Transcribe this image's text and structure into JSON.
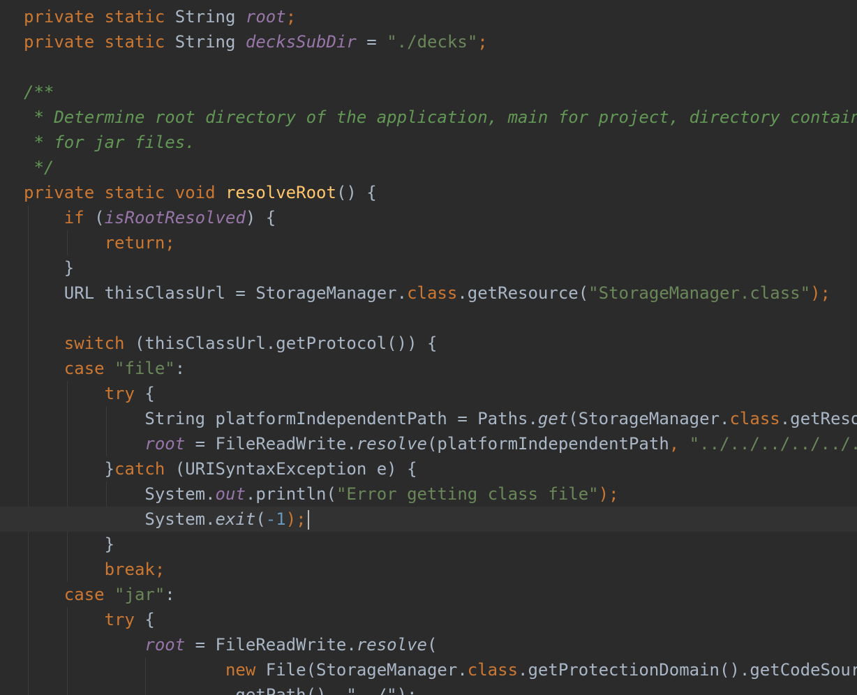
{
  "editor": {
    "current_line_index": 20,
    "lines": [
      {
        "tokens": [
          {
            "t": "private static ",
            "c": "kw"
          },
          {
            "t": "String ",
            "c": "plain"
          },
          {
            "t": "root",
            "c": "static"
          },
          {
            "t": ";",
            "c": "kw"
          }
        ]
      },
      {
        "tokens": [
          {
            "t": "private static ",
            "c": "kw"
          },
          {
            "t": "String ",
            "c": "plain"
          },
          {
            "t": "decksSubDir",
            "c": "static"
          },
          {
            "t": " = ",
            "c": "plain"
          },
          {
            "t": "\"./decks\"",
            "c": "str"
          },
          {
            "t": ";",
            "c": "kw"
          }
        ]
      },
      {
        "tokens": []
      },
      {
        "tokens": [
          {
            "t": "/**",
            "c": "doc"
          }
        ]
      },
      {
        "tokens": [
          {
            "t": " * Determine root directory of the application, main for project, directory containing",
            "c": "doc"
          }
        ]
      },
      {
        "tokens": [
          {
            "t": " * for jar files.",
            "c": "doc"
          }
        ]
      },
      {
        "tokens": [
          {
            "t": " */",
            "c": "doc"
          }
        ]
      },
      {
        "tokens": [
          {
            "t": "private static void ",
            "c": "kw"
          },
          {
            "t": "resolveRoot",
            "c": "fn"
          },
          {
            "t": "() {",
            "c": "plain"
          }
        ]
      },
      {
        "tokens": [
          {
            "t": "    ",
            "c": "plain"
          },
          {
            "t": "if ",
            "c": "kw"
          },
          {
            "t": "(",
            "c": "plain"
          },
          {
            "t": "isRootResolved",
            "c": "static"
          },
          {
            "t": ") {",
            "c": "plain"
          }
        ]
      },
      {
        "tokens": [
          {
            "t": "        ",
            "c": "plain"
          },
          {
            "t": "return;",
            "c": "kw"
          }
        ]
      },
      {
        "tokens": [
          {
            "t": "    }",
            "c": "plain"
          }
        ]
      },
      {
        "tokens": [
          {
            "t": "    URL thisClassUrl = StorageManager.",
            "c": "plain"
          },
          {
            "t": "class",
            "c": "kw"
          },
          {
            "t": ".getResource(",
            "c": "plain"
          },
          {
            "t": "\"StorageManager.class\"",
            "c": "str"
          },
          {
            "t": ");",
            "c": "kw"
          }
        ]
      },
      {
        "tokens": []
      },
      {
        "tokens": [
          {
            "t": "    ",
            "c": "plain"
          },
          {
            "t": "switch ",
            "c": "kw"
          },
          {
            "t": "(thisClassUrl.getProtocol()) {",
            "c": "plain"
          }
        ]
      },
      {
        "tokens": [
          {
            "t": "    ",
            "c": "plain"
          },
          {
            "t": "case ",
            "c": "kw"
          },
          {
            "t": "\"file\"",
            "c": "str"
          },
          {
            "t": ":",
            "c": "plain"
          }
        ]
      },
      {
        "tokens": [
          {
            "t": "        ",
            "c": "plain"
          },
          {
            "t": "try ",
            "c": "kw"
          },
          {
            "t": "{",
            "c": "plain"
          }
        ]
      },
      {
        "tokens": [
          {
            "t": "            String platformIndependentPath = Paths.",
            "c": "plain"
          },
          {
            "t": "get",
            "c": "italic"
          },
          {
            "t": "(StorageManager.",
            "c": "plain"
          },
          {
            "t": "class",
            "c": "kw"
          },
          {
            "t": ".getResourc",
            "c": "plain"
          }
        ]
      },
      {
        "tokens": [
          {
            "t": "            ",
            "c": "plain"
          },
          {
            "t": "root",
            "c": "static"
          },
          {
            "t": " = FileReadWrite.",
            "c": "plain"
          },
          {
            "t": "resolve",
            "c": "italic"
          },
          {
            "t": "(platformIndependentPath",
            "c": "plain"
          },
          {
            "t": ", ",
            "c": "kw"
          },
          {
            "t": "\"../../../../../../",
            "c": "str"
          }
        ]
      },
      {
        "tokens": [
          {
            "t": "        }",
            "c": "plain"
          },
          {
            "t": "catch ",
            "c": "kw"
          },
          {
            "t": "(URISyntaxException e) {",
            "c": "plain"
          }
        ]
      },
      {
        "tokens": [
          {
            "t": "            System.",
            "c": "plain"
          },
          {
            "t": "out",
            "c": "static"
          },
          {
            "t": ".println(",
            "c": "plain"
          },
          {
            "t": "\"Error getting class file\"",
            "c": "str"
          },
          {
            "t": ");",
            "c": "kw"
          }
        ]
      },
      {
        "tokens": [
          {
            "t": "            System.",
            "c": "plain"
          },
          {
            "t": "exit",
            "c": "italic"
          },
          {
            "t": "(",
            "c": "plain"
          },
          {
            "t": "-1",
            "c": "num"
          },
          {
            "t": ");",
            "c": "kw"
          }
        ],
        "caret": true
      },
      {
        "tokens": [
          {
            "t": "        }",
            "c": "plain"
          }
        ]
      },
      {
        "tokens": [
          {
            "t": "        ",
            "c": "plain"
          },
          {
            "t": "break;",
            "c": "kw"
          }
        ]
      },
      {
        "tokens": [
          {
            "t": "    ",
            "c": "plain"
          },
          {
            "t": "case ",
            "c": "kw"
          },
          {
            "t": "\"jar\"",
            "c": "str"
          },
          {
            "t": ":",
            "c": "plain"
          }
        ]
      },
      {
        "tokens": [
          {
            "t": "        ",
            "c": "plain"
          },
          {
            "t": "try ",
            "c": "kw"
          },
          {
            "t": "{",
            "c": "plain"
          }
        ]
      },
      {
        "tokens": [
          {
            "t": "            ",
            "c": "plain"
          },
          {
            "t": "root",
            "c": "static"
          },
          {
            "t": " = FileReadWrite.",
            "c": "plain"
          },
          {
            "t": "resolve",
            "c": "italic"
          },
          {
            "t": "(",
            "c": "plain"
          }
        ]
      },
      {
        "tokens": [
          {
            "t": "                    ",
            "c": "plain"
          },
          {
            "t": "new ",
            "c": "kw"
          },
          {
            "t": "File(StorageManager.",
            "c": "plain"
          },
          {
            "t": "class",
            "c": "kw"
          },
          {
            "t": ".getProtectionDomain().getCodeSource",
            "c": "plain"
          }
        ]
      },
      {
        "tokens": [
          {
            "t": "                    .getPath(), \"../\");",
            "c": "plain"
          }
        ]
      }
    ]
  },
  "colors": {
    "background": "#2b2b2b",
    "current_line": "#323232",
    "keyword": "#cc7832",
    "string": "#6a8759",
    "static_field": "#9876aa",
    "function_decl": "#ffc66d",
    "doc_comment": "#629755",
    "number": "#6897bb",
    "plain": "#a9b7c6"
  }
}
